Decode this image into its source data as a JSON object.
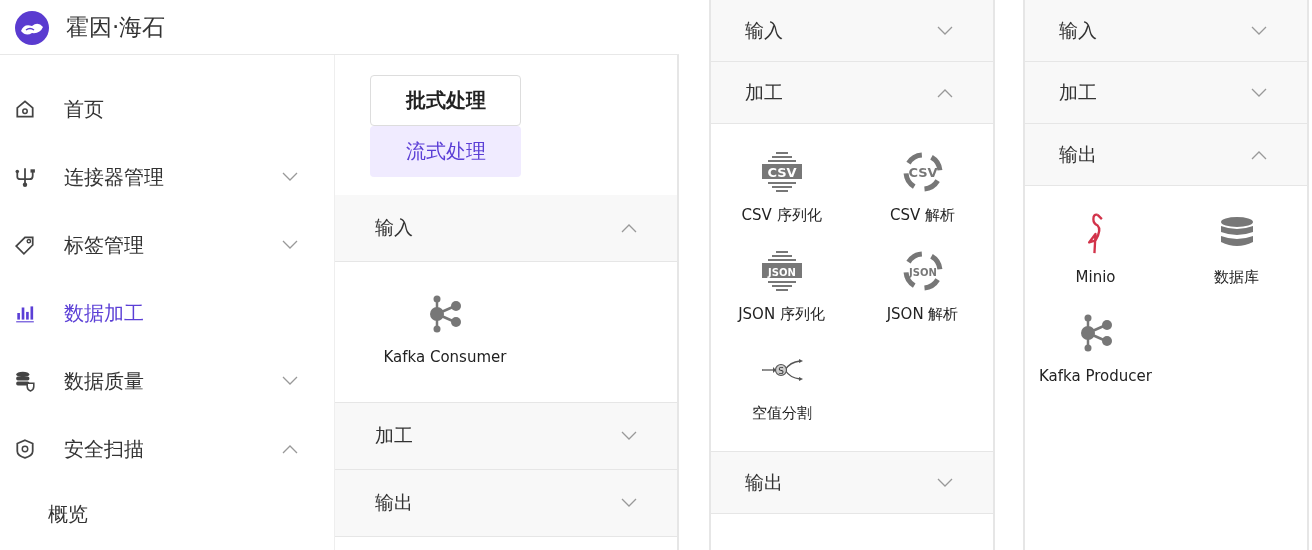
{
  "brand": {
    "name": "霍因·海石"
  },
  "sidebar": {
    "items": [
      {
        "label": "首页",
        "kind": "home",
        "selected": false
      },
      {
        "label": "连接器管理",
        "kind": "usb",
        "selected": false,
        "expanded": false
      },
      {
        "label": "标签管理",
        "kind": "tag",
        "selected": false,
        "expanded": false
      },
      {
        "label": "数据加工",
        "kind": "bars",
        "selected": true
      },
      {
        "label": "数据质量",
        "kind": "db-shield",
        "selected": false,
        "expanded": false
      },
      {
        "label": "安全扫描",
        "kind": "shield",
        "selected": false,
        "expanded": true,
        "children": [
          {
            "label": "概览",
            "selected": false
          }
        ]
      }
    ]
  },
  "mode_tabs": [
    {
      "label": "批式处理",
      "selected": false
    },
    {
      "label": "流式处理",
      "selected": true
    }
  ],
  "panels": [
    {
      "sections": [
        {
          "title": "输入",
          "expanded": true,
          "items": [
            {
              "kind": "kafka",
              "label": "Kafka Consumer"
            }
          ]
        },
        {
          "title": "加工",
          "expanded": false
        },
        {
          "title": "输出",
          "expanded": false
        }
      ]
    },
    {
      "sections": [
        {
          "title": "输入",
          "expanded": false
        },
        {
          "title": "加工",
          "expanded": true,
          "items": [
            {
              "kind": "striped",
              "icon_text": "CSV",
              "label": "CSV 序列化"
            },
            {
              "kind": "ring",
              "icon_text": "CSV",
              "label": "CSV 解析"
            },
            {
              "kind": "striped",
              "icon_text": "JSON",
              "label": "JSON 序列化"
            },
            {
              "kind": "ring",
              "icon_text": "JSON",
              "label": "JSON 解析"
            },
            {
              "kind": "split",
              "icon_text": "S",
              "label": "空值分割"
            }
          ]
        },
        {
          "title": "输出",
          "expanded": false
        }
      ]
    },
    {
      "sections": [
        {
          "title": "输入",
          "expanded": false
        },
        {
          "title": "加工",
          "expanded": false
        },
        {
          "title": "输出",
          "expanded": true,
          "items": [
            {
              "kind": "bird",
              "label": "Minio"
            },
            {
              "kind": "database",
              "label": "数据库"
            },
            {
              "kind": "kafka",
              "label": "Kafka Producer"
            }
          ]
        }
      ]
    }
  ]
}
